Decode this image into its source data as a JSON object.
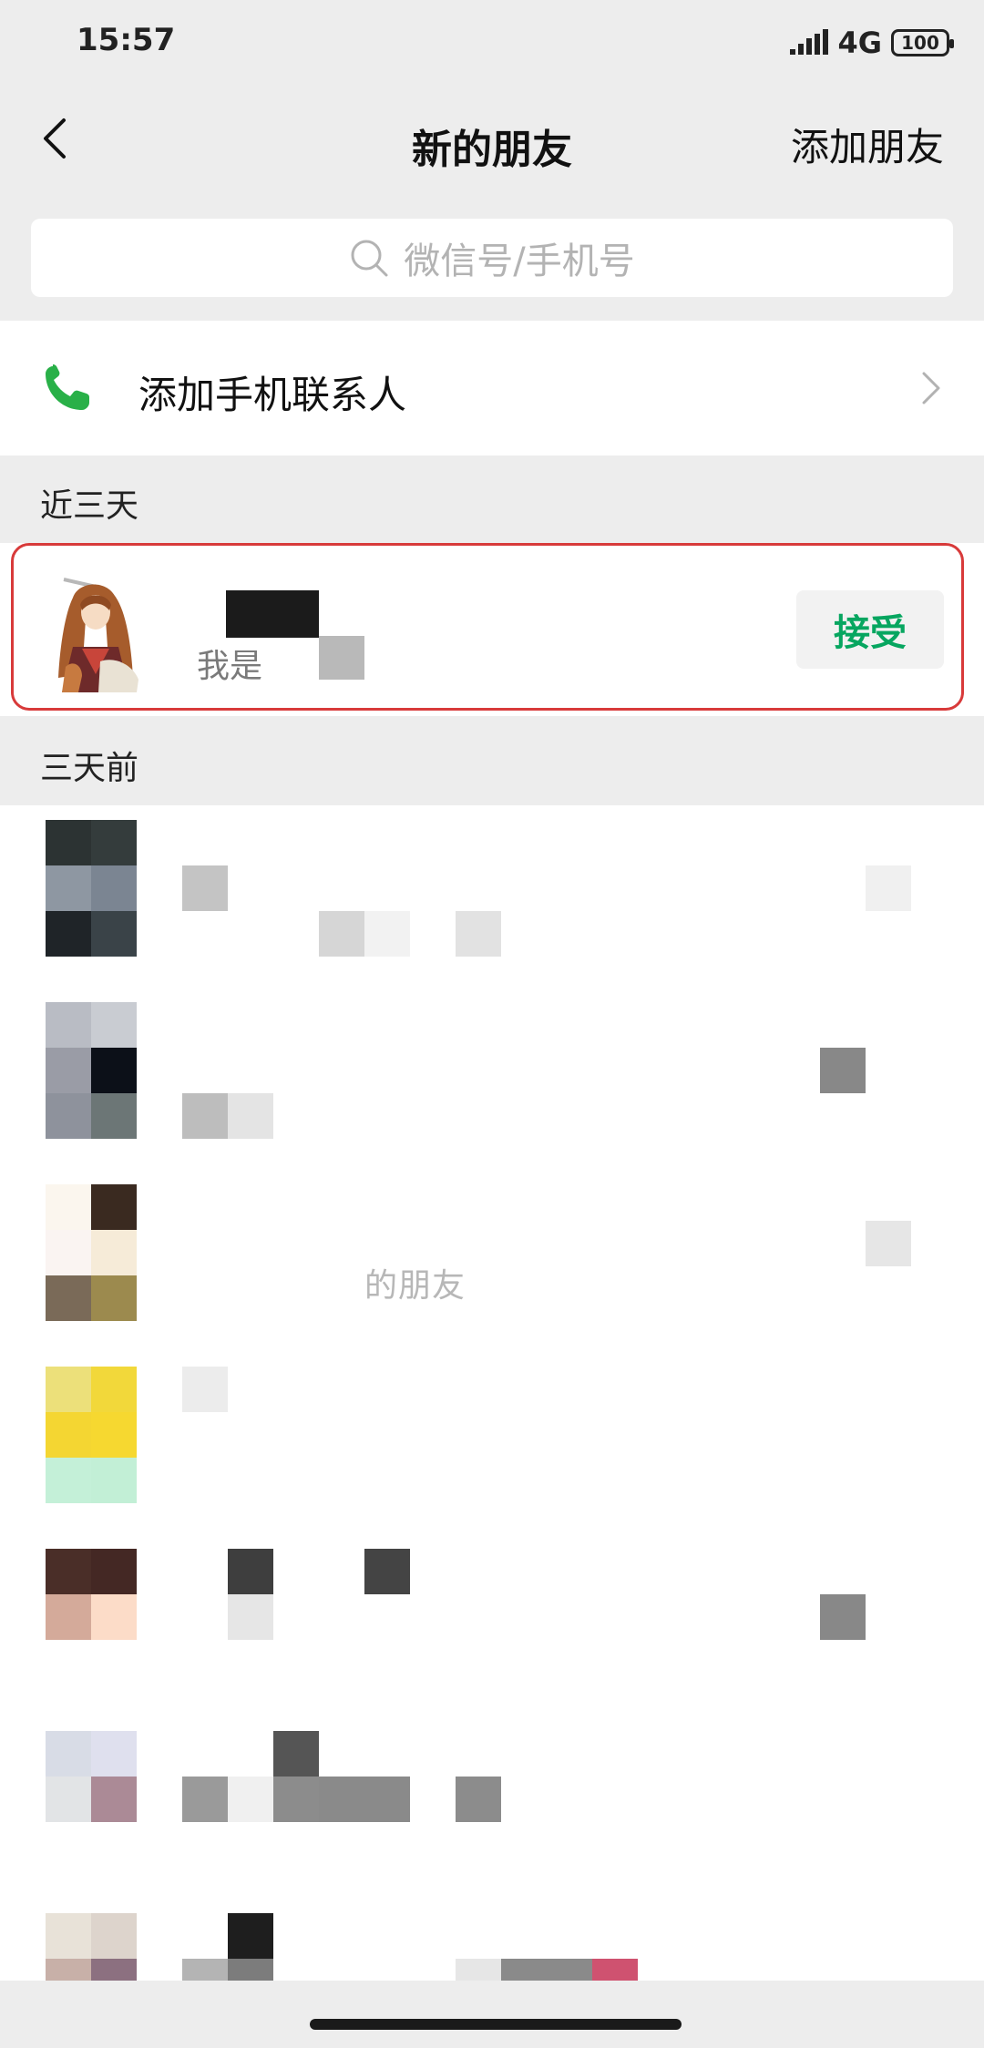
{
  "status_bar": {
    "time": "15:57",
    "network": "4G",
    "battery": "100"
  },
  "nav": {
    "title": "新的朋友",
    "action_label": "添加朋友",
    "back_icon": "chevron-left-icon"
  },
  "search": {
    "placeholder": "微信号/手机号",
    "icon": "search-icon"
  },
  "contacts_row": {
    "label": "添加手机联系人",
    "icon": "phone-icon",
    "accent_color": "#29b048"
  },
  "sections": {
    "recent_header": "近三天",
    "older_header": "三天前"
  },
  "recent_request": {
    "message_prefix": "我是",
    "accept_label": "接受",
    "accept_color": "#07a660",
    "highlight_color": "#d83a3a"
  },
  "older_request_note": "的朋友"
}
